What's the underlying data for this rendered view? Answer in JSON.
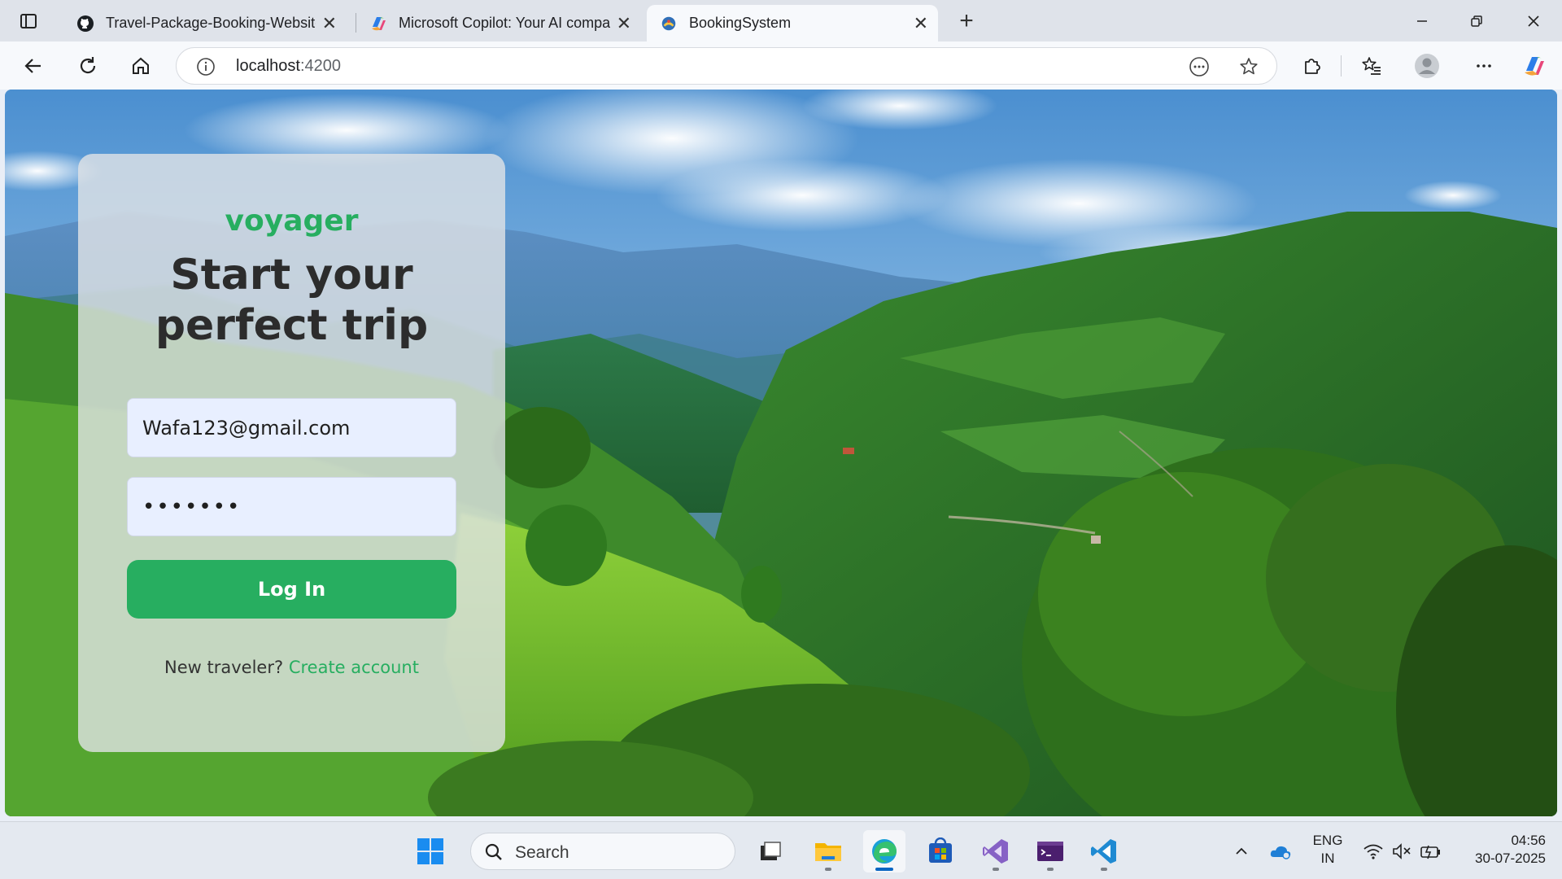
{
  "browser": {
    "tabs": [
      {
        "title": "Travel-Package-Booking-Website",
        "icon": "github-icon",
        "active": false
      },
      {
        "title": "Microsoft Copilot: Your AI companion",
        "icon": "copilot-icon",
        "active": false
      },
      {
        "title": "BookingSystem",
        "icon": "booking-icon",
        "active": true
      }
    ],
    "address": {
      "host": "localhost",
      "port": ":4200"
    }
  },
  "login": {
    "brand": "voyager",
    "headline_line1": "Start your",
    "headline_line2": "perfect trip",
    "email_value": "Wafa123@gmail.com",
    "password_value": "•••••••",
    "login_label": "Log In",
    "signup_prompt": "New traveler?",
    "signup_link": "Create account"
  },
  "taskbar": {
    "search_placeholder": "Search",
    "lang_line1": "ENG",
    "lang_line2": "IN",
    "time": "04:56",
    "date": "30-07-2025"
  },
  "colors": {
    "accent_green": "#27ae60",
    "input_bg": "#e8efff",
    "card_bg": "rgba(225,228,230,0.80)"
  }
}
